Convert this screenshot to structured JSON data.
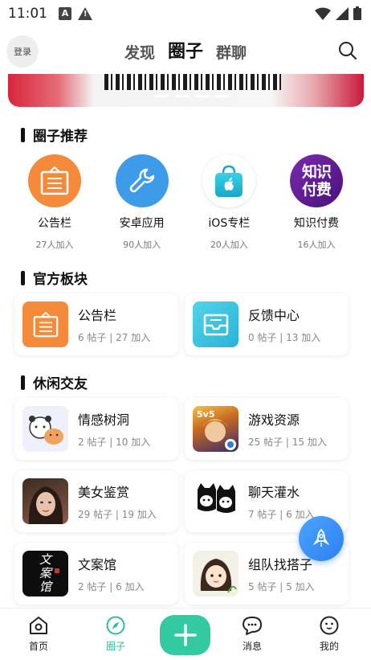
{
  "status_bar": {
    "time": "11:01"
  },
  "header": {
    "login_label": "登录",
    "tabs": [
      {
        "label": "发现",
        "active": false
      },
      {
        "label": "圈子",
        "active": true
      },
      {
        "label": "群聊",
        "active": false
      }
    ]
  },
  "banner": {
    "active_dot": 0,
    "dot_count": 4
  },
  "sections": {
    "recommended": {
      "title": "圈子推荐",
      "items": [
        {
          "name": "公告栏",
          "count": "27人加入",
          "icon": "notice-board-icon"
        },
        {
          "name": "安卓应用",
          "count": "90人加入",
          "icon": "wrench-icon"
        },
        {
          "name": "iOS专栏",
          "count": "20人加入",
          "icon": "apple-bag-icon"
        },
        {
          "name": "知识付费",
          "count": "16人加入",
          "icon": "paid-knowledge-icon",
          "icon_text": "知识付费"
        }
      ]
    },
    "official": {
      "title": "官方板块",
      "items": [
        {
          "name": "公告栏",
          "meta": "6 帖子 | 27 加入",
          "icon": "notice-board-icon"
        },
        {
          "name": "反馈中心",
          "meta": "0 帖子 | 13 加入",
          "icon": "mail-icon"
        }
      ]
    },
    "leisure": {
      "title": "休闲交友",
      "items": [
        {
          "name": "情感树洞",
          "meta": "2 帖子 | 10 加入",
          "icon": "bears-image"
        },
        {
          "name": "游戏资源",
          "meta": "25 帖子 | 15 加入",
          "icon": "game-hero-image"
        },
        {
          "name": "美女鉴赏",
          "meta": "29 帖子 | 19 加入",
          "icon": "portrait-image"
        },
        {
          "name": "聊天灌水",
          "meta": "7 帖子 | 6 加入",
          "icon": "cats-image"
        },
        {
          "name": "文案馆",
          "meta": "2 帖子 | 6 加入",
          "icon": "calligraphy-image",
          "icon_text": "文案馆"
        },
        {
          "name": "组队找搭子",
          "meta": "5 帖子 | 5 加入",
          "icon": "girl-drawing-image"
        }
      ]
    }
  },
  "bottom_nav": [
    {
      "label": "首页",
      "icon": "home-icon",
      "active": false
    },
    {
      "label": "圈子",
      "icon": "compass-icon",
      "active": true
    },
    {
      "label": "消息",
      "icon": "chat-icon",
      "active": false
    },
    {
      "label": "我的",
      "icon": "profile-icon",
      "active": false
    }
  ],
  "colors": {
    "accent": "#33c9a1",
    "notice_orange": "#f58a3a",
    "wrench_blue": "#3e9be9",
    "ios_teal": "#29c3d8",
    "paid_purple": "#5b1a8a",
    "mail_cyan": "#3fc6e0",
    "rocket_blue": "#2f7ff0"
  }
}
